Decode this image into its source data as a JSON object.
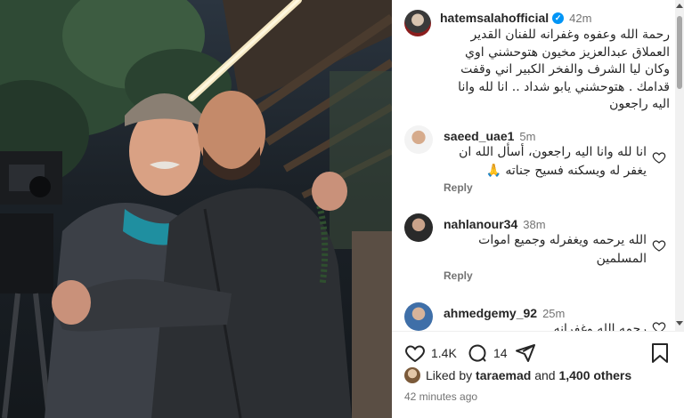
{
  "post": {
    "username": "hatemsalahofficial",
    "time": "42m",
    "caption": "رحمة الله وعفوه وغفرانه للفنان القدير العملاق عبدالعزيز مخيون هتوحشني اوي وكان ليا الشرف والفخر الكبير اني وقفت قدامك . هتوحشني يابو شداد .. انا لله وانا اليه راجعون"
  },
  "comments": [
    {
      "username": "saeed_uae1",
      "time": "5m",
      "text": "انا لله وانا اليه راجعون، أسأل الله ان يغفر له ويسكنه فسيح جناته 🙏",
      "reply": "Reply"
    },
    {
      "username": "nahlanour34",
      "time": "38m",
      "text": "الله يرحمه ويغفرله وجميع اموات المسلمين",
      "reply": "Reply"
    },
    {
      "username": "ahmedgemy_92",
      "time": "25m",
      "text": "رحمه الله وغفرانه",
      "reply": ""
    }
  ],
  "actions": {
    "likes": "1.4K",
    "comments": "14",
    "liked_by_prefix": "Liked by",
    "liked_by_user": "taraemad",
    "liked_by_and": "and",
    "liked_by_others": "1,400 others",
    "time_ago": "42 minutes ago"
  },
  "colors": {
    "verified": "#0095f6",
    "text": "#262626",
    "muted": "#737373",
    "scarf": "#1f8fa0"
  },
  "icons": [
    "verified-icon",
    "heart-icon",
    "comment-icon",
    "share-icon",
    "bookmark-icon"
  ]
}
